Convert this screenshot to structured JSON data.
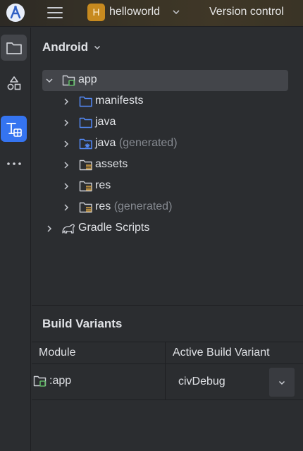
{
  "titlebar": {
    "project_initial": "H",
    "project_name": "helloworld",
    "vcs_label": "Version control"
  },
  "colors": {
    "accent": "#3574f0",
    "folder_blue": "#548af7",
    "module_green": "#5fb865",
    "project_badge": "#c78a1f"
  },
  "toolstrip": {
    "items": [
      {
        "name": "project-tool",
        "icon": "folder-icon"
      },
      {
        "name": "resource-manager-tool",
        "icon": "shapes-icon"
      },
      {
        "name": "build-variants-tool",
        "icon": "build-variants-icon"
      },
      {
        "name": "more-tools",
        "icon": "more-icon"
      }
    ]
  },
  "project_panel": {
    "view_label": "Android",
    "tree": [
      {
        "label": "app",
        "suffix": "",
        "icon": "module-folder-icon",
        "expanded": true
      },
      {
        "label": "manifests",
        "suffix": "",
        "icon": "folder-icon",
        "expanded": false
      },
      {
        "label": "java",
        "suffix": "",
        "icon": "folder-icon",
        "expanded": false
      },
      {
        "label": "java",
        "suffix": "(generated)",
        "icon": "generated-folder-icon",
        "expanded": false
      },
      {
        "label": "assets",
        "suffix": "",
        "icon": "resource-folder-icon",
        "expanded": false
      },
      {
        "label": "res",
        "suffix": "",
        "icon": "resource-folder-icon",
        "expanded": false
      },
      {
        "label": "res",
        "suffix": "(generated)",
        "icon": "resource-folder-icon",
        "expanded": false
      },
      {
        "label": "Gradle Scripts",
        "suffix": "",
        "icon": "gradle-icon",
        "expanded": false
      }
    ]
  },
  "build_variants": {
    "title": "Build Variants",
    "columns": [
      "Module",
      "Active Build Variant"
    ],
    "rows": [
      {
        "module": ":app",
        "variant": "civDebug"
      }
    ]
  }
}
